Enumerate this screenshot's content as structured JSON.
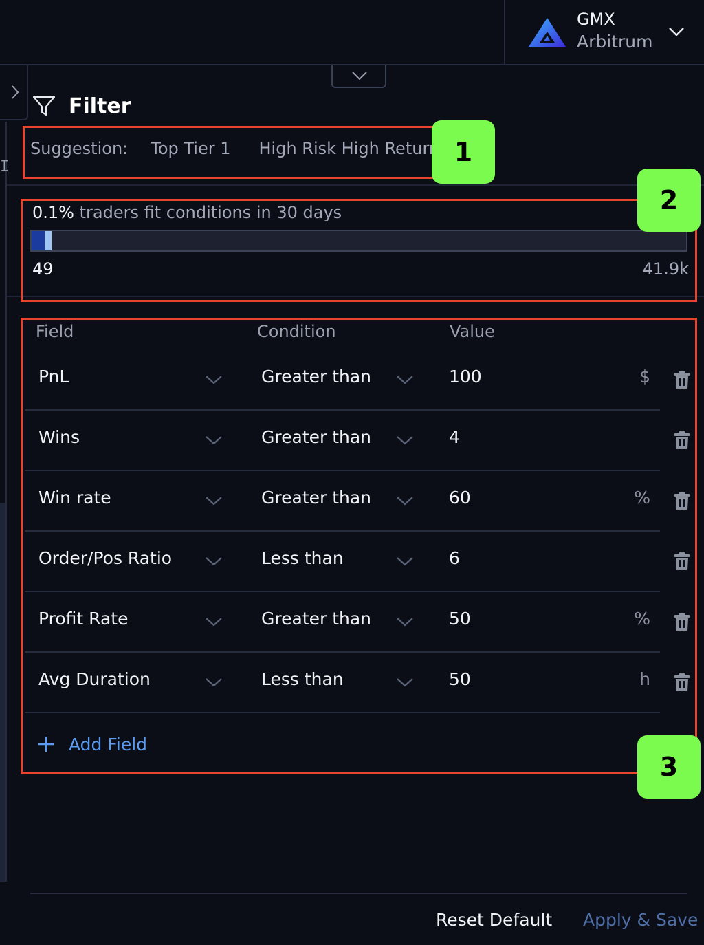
{
  "network": {
    "name": "GMX",
    "chain": "Arbitrum"
  },
  "filter": {
    "title": "Filter"
  },
  "suggestions": {
    "label": "Suggestion:",
    "items": [
      "Top Tier 1",
      "High Risk High Return"
    ]
  },
  "stats": {
    "percent": "0.1%",
    "text": "traders fit conditions in 30 days",
    "min_label": "49",
    "max_label": "41.9k",
    "fill_fraction": 0.03
  },
  "table": {
    "headers": {
      "field": "Field",
      "condition": "Condition",
      "value": "Value"
    },
    "rows": [
      {
        "field": "PnL",
        "condition": "Greater than",
        "value": "100",
        "unit": "$"
      },
      {
        "field": "Wins",
        "condition": "Greater than",
        "value": "4",
        "unit": ""
      },
      {
        "field": "Win rate",
        "condition": "Greater than",
        "value": "60",
        "unit": "%"
      },
      {
        "field": "Order/Pos Ratio",
        "condition": "Less than",
        "value": "6",
        "unit": ""
      },
      {
        "field": "Profit Rate",
        "condition": "Greater than",
        "value": "50",
        "unit": "%"
      },
      {
        "field": "Avg Duration",
        "condition": "Less than",
        "value": "50",
        "unit": "h"
      }
    ],
    "add_field_label": "Add Field"
  },
  "annotations": [
    "1",
    "2",
    "3"
  ],
  "footer": {
    "reset_label": "Reset Default",
    "apply_label": "Apply & Save"
  },
  "colors": {
    "background": "#0b0e17",
    "accent_blue": "#5b9cf0",
    "annotation_red": "#e8432d",
    "annotation_green": "#7cfb4f",
    "range_fill": "#1c3b9e",
    "range_handle": "#9fc5f2"
  },
  "rail_glyph": "I"
}
